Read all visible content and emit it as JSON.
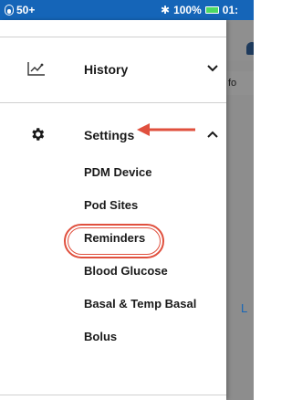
{
  "status_bar": {
    "pod_level": "50+",
    "bluetooth": "✱",
    "battery_percent": "100%",
    "time": "01:",
    "bg_color": "#1565b8",
    "battery_color": "#4cd964"
  },
  "background_app": {
    "info_text": "fo",
    "bottom_letter": "L"
  },
  "menu": {
    "history_label": "History",
    "settings_label": "Settings",
    "settings_items": [
      {
        "label": "PDM Device"
      },
      {
        "label": "Pod Sites"
      },
      {
        "label": "Reminders"
      },
      {
        "label": "Blood Glucose"
      },
      {
        "label": "Basal & Temp Basal"
      },
      {
        "label": "Bolus"
      }
    ]
  },
  "annotation": {
    "highlight_color": "#e0503e",
    "highlighted_item": "Reminders"
  }
}
